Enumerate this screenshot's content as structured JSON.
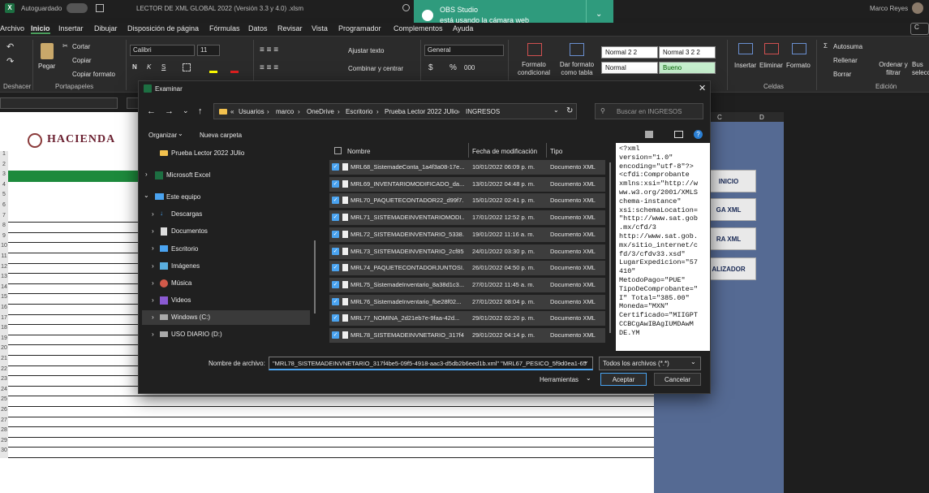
{
  "titlebar": {
    "autosave": "Autoguardado",
    "filename": "LECTOR DE XML GLOBAL 2022 (Versión 3.3 y 4.0) .xlsm",
    "user": "Marco Reyes"
  },
  "notification": {
    "app": "OBS Studio",
    "message": "está usando la cámara web"
  },
  "ribbon_tabs": [
    "Archivo",
    "Inicio",
    "Insertar",
    "Dibujar",
    "Disposición de página",
    "Fórmulas",
    "Datos",
    "Revisar",
    "Vista",
    "Programador",
    "Complementos",
    "Ayuda"
  ],
  "ribbon": {
    "undo_group": "Deshacer",
    "clipboard": {
      "paste": "Pegar",
      "cut": "Cortar",
      "copy": "Copiar",
      "format_painter": "Copiar formato",
      "label": "Portapapeles"
    },
    "font": {
      "name": "Calibri",
      "size": "11",
      "bold": "N",
      "italic": "K",
      "underline": "S"
    },
    "alignment": {
      "wrap": "Ajustar texto",
      "merge": "Combinar y centrar"
    },
    "number": {
      "format": "General",
      "currency": "$",
      "percent": "%",
      "thousands": "000"
    },
    "styles": {
      "cond_format": "Formato condicional",
      "table_format": "Dar formato como tabla",
      "cells": [
        "Normal 2 2",
        "Normal 3 2 2",
        "Normal",
        "Bueno"
      ]
    },
    "cells": {
      "insert": "Insertar",
      "delete": "Eliminar",
      "format": "Formato",
      "label": "Celdas"
    },
    "editing": {
      "autosum": "Autosuma",
      "fill": "Rellenar",
      "clear": "Borrar",
      "sort": "Ordenar y filtrar",
      "find": "Bus selecc",
      "label": "Edición"
    },
    "colors": {
      "good_bg": "#c6efce",
      "good_fg": "#006100"
    }
  },
  "sheet": {
    "logo_text": "HACIENDA",
    "col_c": "C",
    "col_d": "D",
    "row_numbers": [
      "1",
      "2",
      "3",
      "4",
      "5",
      "6",
      "7",
      "8",
      "9",
      "10",
      "11",
      "12",
      "13",
      "14",
      "15",
      "16",
      "17",
      "18",
      "19",
      "20",
      "21",
      "22",
      "23",
      "24",
      "25",
      "26",
      "27",
      "28",
      "29",
      "30"
    ],
    "buttons": [
      "INICIO",
      "GA XML",
      "RA XML",
      "ALIZADOR"
    ]
  },
  "dialog": {
    "title": "Examinar",
    "breadcrumb": [
      "Usuarios",
      "marco",
      "OneDrive",
      "Escritorio",
      "Prueba Lector 2022 JUlio",
      "INGRESOS"
    ],
    "search_placeholder": "Buscar en INGRESOS",
    "organize": "Organizar",
    "new_folder": "Nueva carpeta",
    "nav": [
      {
        "label": "Prueba Lector 2022 JUlio",
        "icon": "folder-icon"
      },
      {
        "label": "Microsoft Excel",
        "icon": "excel-icon"
      },
      {
        "label": "Este equipo",
        "icon": "computer-icon"
      },
      {
        "label": "Descargas",
        "icon": "download-icon"
      },
      {
        "label": "Documentos",
        "icon": "documents-icon"
      },
      {
        "label": "Escritorio",
        "icon": "desktop-icon"
      },
      {
        "label": "Imágenes",
        "icon": "pictures-icon"
      },
      {
        "label": "Música",
        "icon": "music-icon"
      },
      {
        "label": "Videos",
        "icon": "videos-icon"
      },
      {
        "label": "Windows (C:)",
        "icon": "drive-icon"
      },
      {
        "label": "USO DIARIO (D:)",
        "icon": "drive-icon"
      }
    ],
    "columns": {
      "name": "Nombre",
      "date": "Fecha de modificación",
      "type": "Tipo"
    },
    "files": [
      {
        "name": "MRL68_SistemadeConta_1a4f3a08-17e...",
        "date": "10/01/2022 06:09 p. m.",
        "type": "Documento XML"
      },
      {
        "name": "MRL69_INVENTARIOMODIFICADO_da...",
        "date": "13/01/2022 04:48 p. m.",
        "type": "Documento XML"
      },
      {
        "name": "MRL70_PAQUETECONTADOR22_d99f7...",
        "date": "15/01/2022 02:41 p. m.",
        "type": "Documento XML"
      },
      {
        "name": "MRL71_SISTEMADEINVENTARIOMODI...",
        "date": "17/01/2022 12:52 p. m.",
        "type": "Documento XML"
      },
      {
        "name": "MRL72_SISTEMADEINVENTARIO_5338...",
        "date": "19/01/2022 11:16 a. m.",
        "type": "Documento XML"
      },
      {
        "name": "MRL73_SISTEMADEINVENTARIO_2cf85...",
        "date": "24/01/2022 03:30 p. m.",
        "type": "Documento XML"
      },
      {
        "name": "MRL74_PAQUETECONTADORJUNTOSI...",
        "date": "26/01/2022 04:50 p. m.",
        "type": "Documento XML"
      },
      {
        "name": "MRL75_SistemadeInventario_8a38d1c3...",
        "date": "27/01/2022 11:45 a. m.",
        "type": "Documento XML"
      },
      {
        "name": "MRL76_SistemadeInventario_fbe28f02...",
        "date": "27/01/2022 08:04 p. m.",
        "type": "Documento XML"
      },
      {
        "name": "MRL77_NOMINA_2d21eb7e-9faa-42d...",
        "date": "29/01/2022 02:20 p. m.",
        "type": "Documento XML"
      },
      {
        "name": "MRL78_SISTEMADEINVNETARIO_317f4...",
        "date": "29/01/2022 04:14 p. m.",
        "type": "Documento XML"
      }
    ],
    "preview_text": "<?xml\nversion=\"1.0\"\nencoding=\"utf-8\"?>\n<cfdi:Comprobante\nxmlns:xsi=\"http://w\nww.w3.org/2001/XMLS\nchema-instance\"\nxsi:schemaLocation=\n\"http://www.sat.gob\n.mx/cfd/3\nhttp://www.sat.gob.\nmx/sitio_internet/c\nfd/3/cfdv33.xsd\"\nLugarExpedicion=\"57\n410\"\nMetodoPago=\"PUE\"\nTipoDeComprobante=\"\nI\" Total=\"385.00\"\nMoneda=\"MXN\"\nCertificado=\"MIIGPT\nCCBCgAwIBAgIUMDAwM\nDE.YM",
    "filename_label": "Nombre de archivo:",
    "filename_value": "\"MRL78_SISTEMADEINVNETARIO_317f4be5-09f5-4918-aac3-d5db2b6eed1b.xml\" \"MRL67_PESICO_5f9d0ea1-65",
    "filter": "Todos los archivos (*.*)",
    "tools": "Herramientas",
    "accept": "Aceptar",
    "cancel": "Cancelar"
  }
}
